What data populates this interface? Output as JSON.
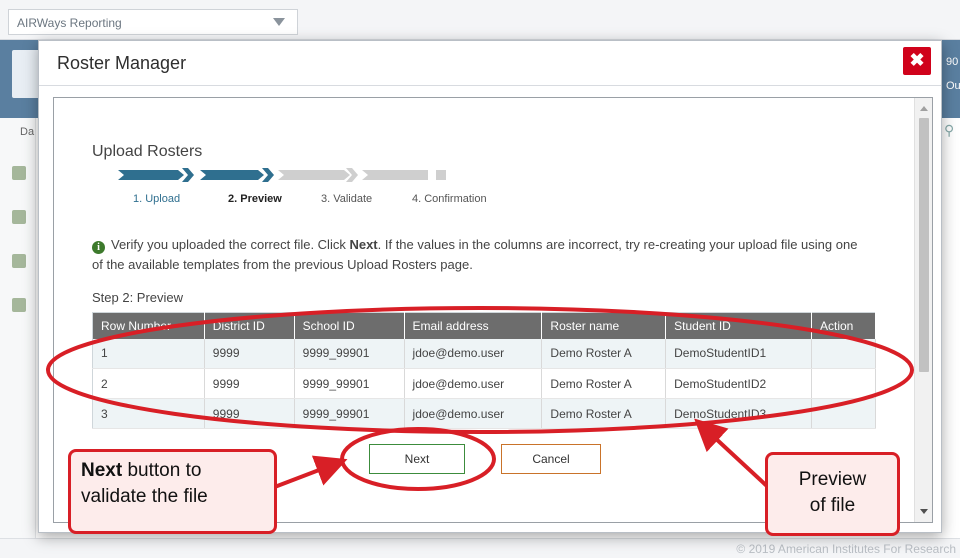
{
  "app": {
    "title": "AIRWays Reporting",
    "banner_text_1": "90",
    "banner_text_2": "Ou",
    "side_label": "Da",
    "footer_text": "© 2019 American Institutes For Research"
  },
  "modal": {
    "title": "Roster Manager",
    "close_symbol": "✖",
    "upload_title": "Upload Rosters",
    "steps": [
      {
        "label": "1. Upload",
        "state": "complete"
      },
      {
        "label": "2. Preview",
        "state": "current"
      },
      {
        "label": "3. Validate",
        "state": "pending"
      },
      {
        "label": "4. Confirmation",
        "state": "pending"
      }
    ],
    "info_prefix": "Verify you uploaded the correct file. Click ",
    "info_bold": "Next",
    "info_suffix": ". If the values in the columns are incorrect, try re-creating your upload file using one of the available templates from the previous Upload Rosters page.",
    "step_label": "Step 2: Preview",
    "table": {
      "headers": [
        "Row Number",
        "District ID",
        "School ID",
        "Email address",
        "Roster name",
        "Student ID",
        "Action"
      ],
      "rows": [
        [
          "1",
          "9999",
          "9999_99901",
          "jdoe@demo.user",
          "Demo Roster A",
          "DemoStudentID1",
          ""
        ],
        [
          "2",
          "9999",
          "9999_99901",
          "jdoe@demo.user",
          "Demo Roster A",
          "DemoStudentID2",
          ""
        ],
        [
          "3",
          "9999",
          "9999_99901",
          "jdoe@demo.user",
          "Demo Roster A",
          "DemoStudentID3",
          ""
        ]
      ]
    },
    "next_label": "Next",
    "cancel_label": "Cancel"
  },
  "annotations": {
    "next_callout_bold": "Next",
    "next_callout_rest_1": " button to",
    "next_callout_rest_2": "validate the file",
    "preview_callout_1": "Preview",
    "preview_callout_2": "of file"
  },
  "colors": {
    "accent_red": "#d81f26",
    "progress_done": "#2f6f8f",
    "progress_pending": "#cfcfcf",
    "next_border": "#3c8c3c",
    "cancel_border": "#c9732a"
  }
}
